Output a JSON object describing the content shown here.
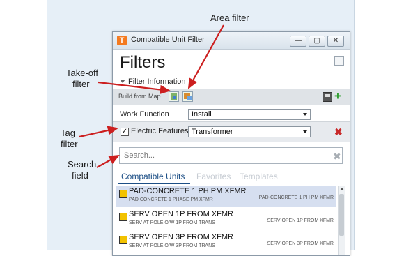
{
  "window": {
    "title": "Compatible Unit Filter",
    "heading": "Filters",
    "buttons": {
      "minimize": "—",
      "maximize": "▢",
      "close": "✕"
    }
  },
  "filter_section": {
    "title": "Filter Information",
    "build_from_map_label": "Build from Map",
    "icons": [
      "take-off-filter-icon",
      "area-filter-icon",
      "save-icon",
      "add-icon"
    ]
  },
  "work_function": {
    "label": "Work Function",
    "value": "Install"
  },
  "tag_filter": {
    "checked": true,
    "label": "Electric Features",
    "value": "Transformer"
  },
  "search": {
    "placeholder": "Search..."
  },
  "tabs": [
    {
      "label": "Compatible Units",
      "active": true
    },
    {
      "label": "Favorites",
      "active": false
    },
    {
      "label": "Templates",
      "active": false
    }
  ],
  "results": [
    {
      "name": "PAD-CONCRETE 1 PH PM XFMR",
      "description": "PAD CONCRETE 1 PHASE PM XFMR",
      "code": "PAD-CONCRETE 1 PH PM XFMR",
      "selected": true
    },
    {
      "name": "SERV OPEN 1P FROM XFMR",
      "description": "SERV AT POLE O/W 1P FROM TRANS",
      "code": "SERV OPEN 1P FROM XFMR",
      "selected": false
    },
    {
      "name": "SERV OPEN 3P FROM XFMR",
      "description": "SERV AT POLE O/W 3P FROM TRANS",
      "code": "SERV OPEN 3P FROM XFMR",
      "selected": false
    }
  ],
  "annotations": {
    "area_filter": "Area filter",
    "take_off_filter_1": "Take-off",
    "take_off_filter_2": "filter",
    "tag_filter_1": "Tag",
    "tag_filter_2": "filter",
    "search_field_1": "Search",
    "search_field_2": "field"
  },
  "colors": {
    "arrow": "#cc1f1f",
    "accent": "#1d4f86",
    "brand": "#f47a20"
  }
}
